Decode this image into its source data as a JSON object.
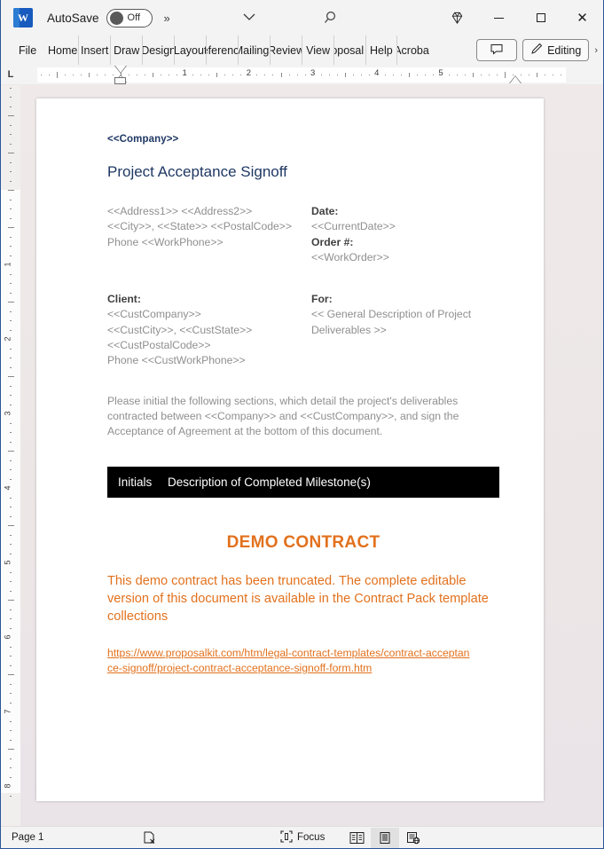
{
  "titlebar": {
    "app_icon": "word-icon",
    "autosave_label": "AutoSave",
    "autosave_state": "Off",
    "more_commands": "»",
    "dropdown_icon": "chevron-down-icon",
    "search_icon": "search-icon",
    "copilot_icon": "diamond-icon",
    "minimize": "minimize-icon",
    "maximize": "maximize-icon",
    "close": "close-icon"
  },
  "ribbon": {
    "tabs": [
      {
        "label": "File"
      },
      {
        "label": "Home"
      },
      {
        "label": "Insert"
      },
      {
        "label": "Draw"
      },
      {
        "label": "Design"
      },
      {
        "label": "Layout"
      },
      {
        "label": "References"
      },
      {
        "label": "Mailings"
      },
      {
        "label": "Review"
      },
      {
        "label": "View"
      },
      {
        "label": "Proposal Kit"
      },
      {
        "label": "Help"
      },
      {
        "label": "Acrobat"
      }
    ],
    "comment_button": "comment-icon",
    "editing_label": "Editing",
    "editing_icon": "pencil-icon",
    "overflow": "›"
  },
  "ruler": {
    "corner_label": "L",
    "horizontal_numbers": [
      "1",
      "2",
      "3",
      "4",
      "5"
    ],
    "vertical_numbers": [
      "1",
      "2",
      "3",
      "4",
      "5",
      "6",
      "7",
      "8"
    ]
  },
  "document": {
    "company": "<<Company>>",
    "title": "Project Acceptance Signoff",
    "sender": {
      "line1": "<<Address1>> <<Address2>>",
      "line2": "<<City>>, <<State>> <<PostalCode>>",
      "line3": "Phone <<WorkPhone>>"
    },
    "meta": {
      "date_label": "Date:",
      "date_value": "<<CurrentDate>>",
      "order_label": "Order #:",
      "order_value": "<<WorkOrder>>"
    },
    "client": {
      "label": "Client:",
      "line1": "<<CustCompany>>",
      "line2": "<<CustCity>>, <<CustState>>",
      "line3": "<<CustPostalCode>>",
      "line4": "Phone <<CustWorkPhone>>"
    },
    "for": {
      "label": "For:",
      "line1": "<< General Description of Project",
      "line2": "Deliverables >>"
    },
    "paragraph": "Please initial the following sections, which detail the project's deliverables contracted between <<Company>> and <<CustCompany>>, and sign the Acceptance of Agreement at the bottom of this document.",
    "table_header": {
      "col1": "Initials",
      "col2": "Description of Completed Milestone(s)"
    },
    "demo": {
      "heading": "DEMO CONTRACT",
      "body": "This demo contract has been truncated. The complete editable version of this document is available in the Contract Pack template collections",
      "link": "https://www.proposalkit.com/htm/legal-contract-templates/contract-acceptance-signoff/project-contract-acceptance-signoff-form.htm"
    },
    "colors": {
      "heading_navy": "#1f3864",
      "placeholder_gray": "#8f8f8f",
      "demo_orange": "#e2711d",
      "table_header_bg": "#000000"
    }
  },
  "statusbar": {
    "page_label": "Page 1",
    "proofing_icon": "proofing-errors-icon",
    "focus_label": "Focus",
    "focus_icon": "focus-icon",
    "view_read": "read-mode-icon",
    "view_print": "print-layout-icon",
    "view_web": "web-layout-icon"
  }
}
